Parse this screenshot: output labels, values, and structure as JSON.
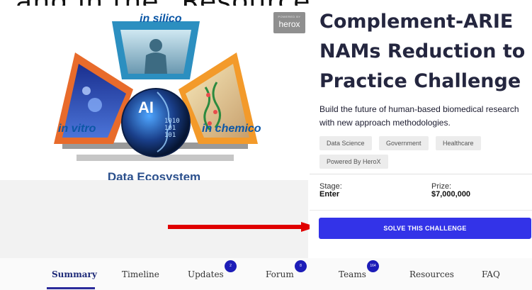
{
  "caption": {
    "text": "and in the \"Resources\" section"
  },
  "graphic": {
    "label_top": "in silico",
    "label_left": "in vitro",
    "label_right": "in chemico",
    "label_center": "AI",
    "label_bottom": "Data Ecosystem",
    "center_digits": "1010\n101\n101"
  },
  "badge": {
    "tiny_text": "POWERED BY",
    "name": "herox"
  },
  "challenge": {
    "title": "Complement-ARIE NAMs Reduction to Practice Challenge",
    "description": "Build the future of human-based biomedical research with new approach methodologies.",
    "tags": [
      "Data Science",
      "Government",
      "Healthcare",
      "Powered By HeroX"
    ],
    "stage_label": "Stage:",
    "stage_value": "Enter",
    "prize_label": "Prize:",
    "prize_value": "$7,000,000",
    "button_label": "SOLVE THIS CHALLENGE"
  },
  "tabs": [
    {
      "label": "Summary",
      "active": true
    },
    {
      "label": "Timeline"
    },
    {
      "label": "Updates",
      "badge": "2"
    },
    {
      "label": "Forum",
      "badge": "8"
    },
    {
      "label": "Teams",
      "badge": "164"
    },
    {
      "label": "Resources"
    },
    {
      "label": "FAQ"
    }
  ],
  "colors": {
    "accent": "#3333e8",
    "arrow": "#e00000",
    "title": "#24263f"
  }
}
